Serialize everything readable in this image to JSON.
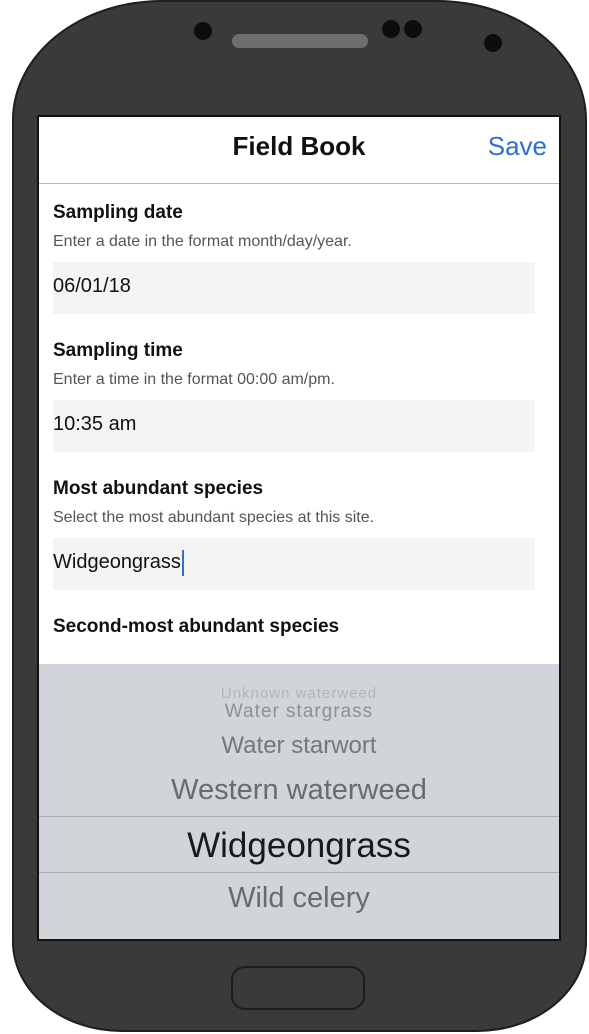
{
  "nav": {
    "title": "Field Book",
    "save_label": "Save"
  },
  "fields": [
    {
      "label": "Sampling date",
      "help": "Enter a date in the format month/day/year.",
      "value": "06/01/18"
    },
    {
      "label": "Sampling time",
      "help": "Enter a time in the format 00:00 am/pm.",
      "value": "10:35 am"
    },
    {
      "label": "Most abundant species",
      "help": "Select the most abundant species at this site.",
      "value": "Widgeongrass"
    },
    {
      "label": "Second-most abundant species"
    }
  ],
  "picker": {
    "options": [
      "Unknown waterweed",
      "Water stargrass",
      "Water starwort",
      "Western waterweed",
      "Widgeongrass",
      "Wild celery"
    ],
    "selected": "Widgeongrass"
  }
}
